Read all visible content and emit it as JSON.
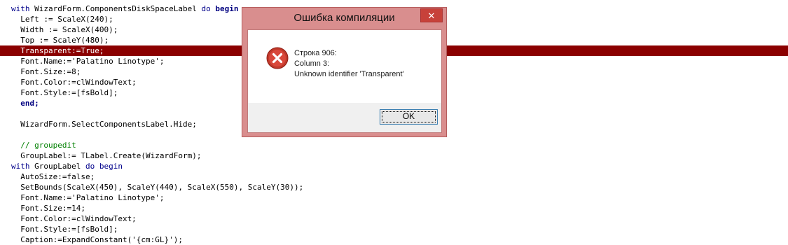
{
  "editor": {
    "lines": [
      {
        "segments": [
          {
            "t": "with",
            "c": "kw"
          },
          {
            "t": " WizardForm.ComponentsDiskSpaceLabel ",
            "c": ""
          },
          {
            "t": "do",
            "c": "kw"
          },
          {
            "t": " begin",
            "c": "kw-bold"
          }
        ]
      },
      {
        "segments": [
          {
            "t": "  Left := ScaleX(240);",
            "c": ""
          }
        ]
      },
      {
        "segments": [
          {
            "t": "  Width := ScaleX(400);",
            "c": ""
          }
        ]
      },
      {
        "segments": [
          {
            "t": "  Top := ScaleY(480);",
            "c": ""
          }
        ]
      },
      {
        "err": true,
        "segments": [
          {
            "t": "  Transparent:=True;",
            "c": ""
          }
        ]
      },
      {
        "segments": [
          {
            "t": "  Font.Name:='Palatino Linotype';",
            "c": ""
          }
        ]
      },
      {
        "segments": [
          {
            "t": "  Font.Size:=8;",
            "c": ""
          }
        ]
      },
      {
        "segments": [
          {
            "t": "  Font.Color:=clWindowText;",
            "c": ""
          }
        ]
      },
      {
        "segments": [
          {
            "t": "  Font.Style:=[fsBold];",
            "c": ""
          }
        ]
      },
      {
        "segments": [
          {
            "t": "  end;",
            "c": "kw-bold"
          }
        ]
      },
      {
        "segments": [
          {
            "t": "",
            "c": ""
          }
        ]
      },
      {
        "segments": [
          {
            "t": "  WizardForm.SelectComponentsLabel.Hide;",
            "c": ""
          }
        ]
      },
      {
        "segments": [
          {
            "t": "",
            "c": ""
          }
        ]
      },
      {
        "segments": [
          {
            "t": "  // groupedit",
            "c": "cm"
          }
        ]
      },
      {
        "segments": [
          {
            "t": "  GroupLabel:= TLabel.Create(WizardForm);",
            "c": ""
          }
        ]
      },
      {
        "segments": [
          {
            "t": "with",
            "c": "kw"
          },
          {
            "t": " GroupLabel ",
            "c": ""
          },
          {
            "t": "do begin",
            "c": "kw"
          }
        ]
      },
      {
        "segments": [
          {
            "t": "  AutoSize:=false;",
            "c": ""
          }
        ]
      },
      {
        "segments": [
          {
            "t": "  SetBounds(ScaleX(450), ScaleY(440), ScaleX(550), ScaleY(30));",
            "c": ""
          }
        ]
      },
      {
        "segments": [
          {
            "t": "  Font.Name:='Palatino Linotype';",
            "c": ""
          }
        ]
      },
      {
        "segments": [
          {
            "t": "  Font.Size:=14;",
            "c": ""
          }
        ]
      },
      {
        "segments": [
          {
            "t": "  Font.Color:=clWindowText;",
            "c": ""
          }
        ]
      },
      {
        "segments": [
          {
            "t": "  Font.Style:=[fsBold];",
            "c": ""
          }
        ]
      },
      {
        "segments": [
          {
            "t": "  Caption:=ExpandConstant('{cm:GL}');",
            "c": ""
          }
        ]
      }
    ]
  },
  "dialog": {
    "title": "Ошибка компиляции",
    "close_glyph": "✕",
    "icon": "error-icon",
    "message_lines": [
      "Строка 906:",
      "Column 3:",
      "Unknown identifier 'Transparent'"
    ],
    "ok_label": "OK"
  },
  "colors": {
    "error_line": "#8b0000",
    "dialog_frame": "#d98e8e",
    "close_button": "#c7413a"
  }
}
